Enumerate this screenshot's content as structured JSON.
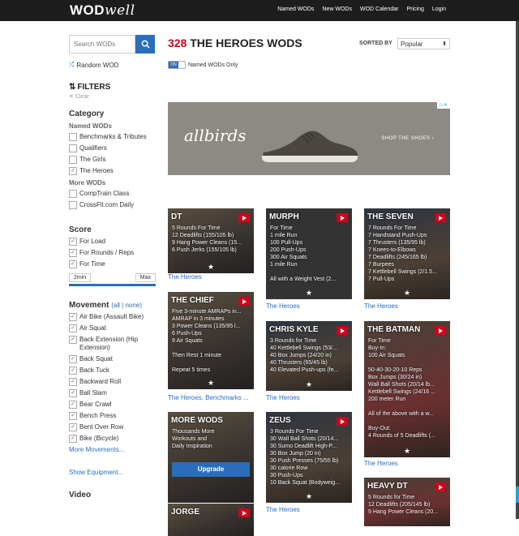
{
  "header": {
    "logo_bold": "WOD",
    "logo_light": "well",
    "nav": [
      "Named WODs",
      "New WODs",
      "WOD Calendar",
      "Pricing",
      "Login"
    ]
  },
  "sidebar": {
    "search_placeholder": "Search WODs",
    "random": "Random WOD",
    "filters": "FILTERS",
    "clear": "Clear",
    "category_title": "Category",
    "named_title": "Named WODs",
    "named_items": [
      {
        "label": "Benchmarks & Tributes",
        "checked": false
      },
      {
        "label": "Qualifiers",
        "checked": false
      },
      {
        "label": "The Girls",
        "checked": false
      },
      {
        "label": "The Heroes",
        "checked": true
      }
    ],
    "more_title": "More WODs",
    "more_items": [
      {
        "label": "CompTrain Class",
        "checked": false
      },
      {
        "label": "CrossFit.com Daily",
        "checked": false
      }
    ],
    "score_title": "Score",
    "score_items": [
      {
        "label": "For Load",
        "checked": true
      },
      {
        "label": "For Rounds / Reps",
        "checked": true
      },
      {
        "label": "For Time",
        "checked": true
      }
    ],
    "range_min": "2min",
    "range_max": "Max",
    "movement_title": "Movement",
    "movement_all": "all",
    "movement_none": "none",
    "movement_items": [
      {
        "label": "Air Bike (Assault Bike)",
        "checked": true
      },
      {
        "label": "Air Squat",
        "checked": true
      },
      {
        "label": "Back Extension (Hip Extension)",
        "checked": true
      },
      {
        "label": "Back Squat",
        "checked": true
      },
      {
        "label": "Back Tuck",
        "checked": true
      },
      {
        "label": "Backward Roll",
        "checked": true
      },
      {
        "label": "Ball Slam",
        "checked": true
      },
      {
        "label": "Bear Crawl",
        "checked": true
      },
      {
        "label": "Bench Press",
        "checked": true
      },
      {
        "label": "Bent Over Row",
        "checked": true
      },
      {
        "label": "Bike (Bicycle)",
        "checked": true
      }
    ],
    "more_movements": "More Movements...",
    "show_equipment": "Show Equipment...",
    "video_title": "Video"
  },
  "main": {
    "count": "328",
    "title": "THE HEROES WODS",
    "sorted_by": "SORTED BY",
    "sort_value": "Popular",
    "toggle_on": "ON",
    "toggle_label": "Named WODs Only",
    "ad": {
      "brand": "allbirds",
      "cta": "SHOP THE SHOES ›"
    }
  },
  "cards": [
    {
      "name": "DT",
      "lines": [
        "5 Rounds For Time",
        "12 Deadlifts (155/105 lb)",
        "9 Hang Power Cleans (15...",
        "6 Push Jerks (155/105 lb)"
      ],
      "category": "The Heroes"
    },
    {
      "name": "MURPH",
      "lines": [
        "For Time",
        "1 mile Run",
        "100 Pull-Ups",
        "200 Push-Ups",
        "300 Air Squats",
        "1 mile Run",
        "",
        "All with a Weight Vest (2..."
      ],
      "category": "The Heroes"
    },
    {
      "name": "THE SEVEN",
      "lines": [
        "7 Rounds For Time",
        "7 Handstand Push-Ups",
        "7 Thrusters (135/95 lb)",
        "7 Knees-to-Elbows",
        "7 Deadlifts (245/165 lb)",
        "7 Burpees",
        "7 Kettlebell Swings (2/1.5...",
        "7 Pull-Ups"
      ],
      "category": "The Heroes"
    },
    {
      "name": "THE CHIEF",
      "lines": [
        "Five 3-minute AMRAPs in...",
        "AMRAP in 3 minutes",
        "3 Power Cleans (135/95 l...",
        "6 Push-Ups",
        "9 Air Squats",
        "",
        "Then Rest 1 minute",
        "",
        "Repeat 5 times"
      ],
      "category": "The Heroes, Benchmarks ..."
    },
    {
      "name": "CHRIS KYLE",
      "lines": [
        "3 Rounds for Time",
        "40 Kettlebell Swings (53/...",
        "40 Box Jumps (24/20 in)",
        "40 Thrusters (65/45 lb)",
        "40 Elevated Push-ups (fe..."
      ],
      "category": "The Heroes"
    },
    {
      "name": "THE BATMAN",
      "lines": [
        "For Time",
        "Buy-In:",
        "100 Air Squats",
        "",
        "50-40-30-20-10 Reps",
        "Box Jumps (30/24 in)",
        "Wall Ball Shots (20/14 lb...",
        "Kettlebell Swings (24/16 ...",
        "200 meter Run",
        "",
        "All of the above with a w...",
        "",
        "Buy-Out:",
        "4 Rounds of 5 Deadlifts (..."
      ],
      "category": "The Heroes"
    },
    {
      "name": "MORE WODS",
      "lines": [
        "Thousands More",
        "Workouts and",
        "Daily Inspiration"
      ],
      "button": "Upgrade"
    },
    {
      "name": "ZEUS",
      "lines": [
        "3 Rounds For Time",
        "30 Wall Ball Shots (20/14...",
        "30 Sumo Deadlift High-P...",
        "30 Box Jump (20 in)",
        "30 Push Presses (75/55 lb)",
        "30 calorie Row",
        "30 Push-Ups",
        "10 Back Squat (Bodyweig..."
      ],
      "category": "The Heroes"
    },
    {
      "name": "HEAVY DT",
      "lines": [
        "5 Rounds for Time",
        "12 Deadlifts (205/145 lb)",
        "9 Hang Power Cleans (20..."
      ]
    },
    {
      "name": "JORGE",
      "lines": []
    }
  ]
}
